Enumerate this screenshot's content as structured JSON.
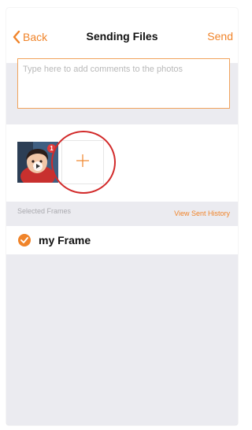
{
  "header": {
    "back_label": "Back",
    "title": "Sending Files",
    "send_label": "Send"
  },
  "comment": {
    "placeholder": "Type here to add comments to the photos",
    "value": ""
  },
  "photos": {
    "items": [
      {
        "badge": "1"
      }
    ],
    "add_icon": "plus-icon"
  },
  "frames": {
    "section_label": "Selected Frames",
    "history_link": "View Sent History",
    "items": [
      {
        "name": "my Frame",
        "selected": true
      }
    ]
  },
  "colors": {
    "accent": "#f0842a",
    "highlight_circle": "#d22a2a",
    "background": "#ebebf0"
  }
}
